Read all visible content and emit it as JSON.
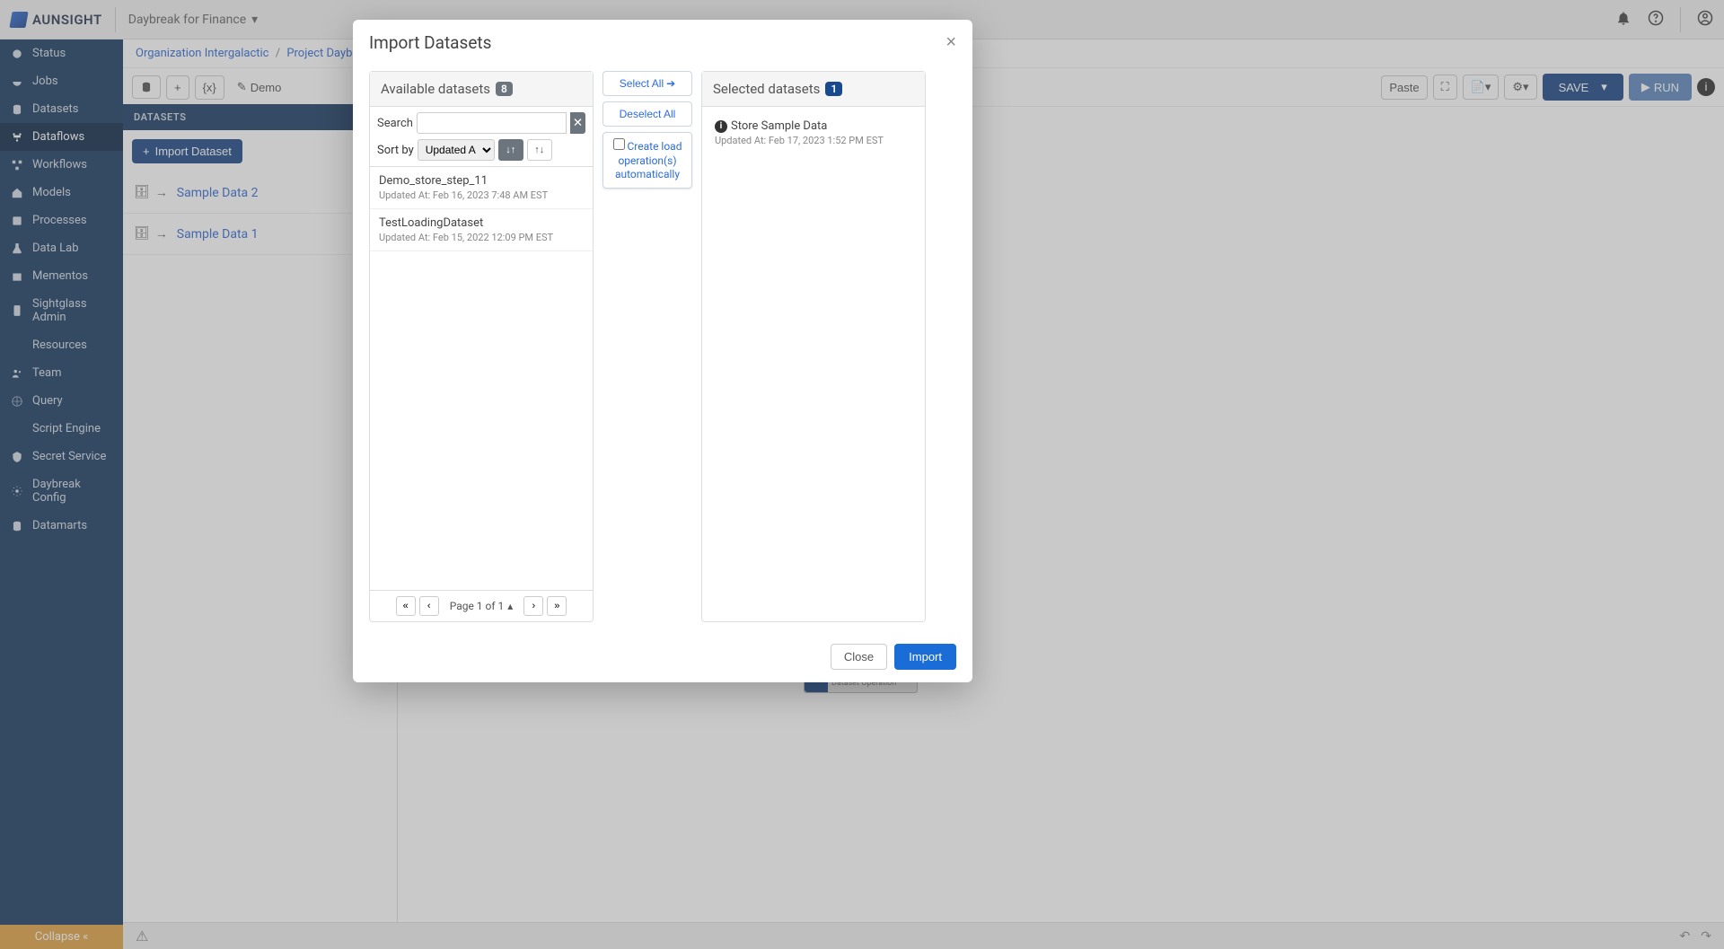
{
  "app": {
    "name": "AUNSIGHT",
    "project": "Daybreak for Finance"
  },
  "topbar": {
    "notifications_icon": "notifications",
    "help_icon": "help",
    "user_icon": "user"
  },
  "breadcrumb": {
    "org_label": "Organization Intergalactic",
    "project_label": "Project Daybreak fo"
  },
  "sidebar": {
    "items": [
      {
        "label": "Status"
      },
      {
        "label": "Jobs"
      },
      {
        "label": "Datasets"
      },
      {
        "label": "Dataflows"
      },
      {
        "label": "Workflows"
      },
      {
        "label": "Models"
      },
      {
        "label": "Processes"
      },
      {
        "label": "Data Lab"
      },
      {
        "label": "Mementos"
      },
      {
        "label": "Sightglass Admin"
      },
      {
        "label": "Resources"
      },
      {
        "label": "Team"
      },
      {
        "label": "Query"
      },
      {
        "label": "Script Engine"
      },
      {
        "label": "Secret Service"
      },
      {
        "label": "Daybreak Config"
      },
      {
        "label": "Datamarts"
      }
    ],
    "collapse_label": "Collapse"
  },
  "toolbar": {
    "demo_label": "Demo",
    "var_label": "{x}",
    "paste_label": "Paste",
    "save_label": "SAVE",
    "run_label": "RUN"
  },
  "datasets_panel": {
    "header": "DATASETS",
    "import_label": "Import Dataset",
    "items": [
      {
        "label": "Sample Data 2"
      },
      {
        "label": "Sample Data 1"
      }
    ]
  },
  "modal": {
    "title": "Import Datasets",
    "available": {
      "title": "Available datasets",
      "count_badge": "8",
      "search_label": "Search",
      "search_placeholder": "",
      "sort_label": "Sort by",
      "sort_value": "Updated At",
      "items": [
        {
          "name": "Demo_store_step_11",
          "meta": "Updated At: Feb 16, 2023 7:48 AM EST"
        },
        {
          "name": "TestLoadingDataset",
          "meta": "Updated At: Feb 15, 2022 12:09 PM EST"
        }
      ],
      "pager_text": "Page 1 of 1"
    },
    "actions": {
      "select_all": "Select All",
      "deselect_all": "Deselect All",
      "create_load": "Create load operation(s) automatically"
    },
    "selected": {
      "title": "Selected datasets",
      "count_badge": "1",
      "items": [
        {
          "name": "Store Sample Data",
          "meta": "Updated At: Feb 17, 2023 1:52 PM EST"
        }
      ]
    },
    "footer": {
      "close": "Close",
      "import": "Import"
    }
  },
  "canvas_hint": "Dataset Operation"
}
